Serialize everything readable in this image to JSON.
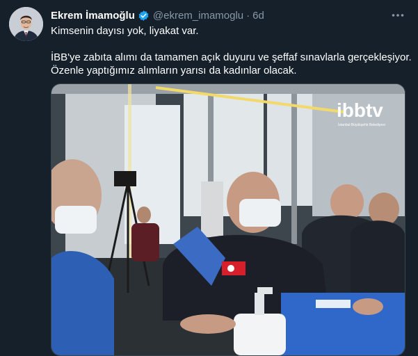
{
  "tweet": {
    "author_name": "Ekrem İmamoğlu",
    "handle": "@ekrem_imamoglu",
    "separator": "·",
    "time": "6d",
    "lines": [
      "Kimsenin dayısı yok, liyakat var.",
      "İBB'ye zabıta alımı da tamamen açık duyuru ve şeffaf sınavlarla gerçekleşiyor.",
      "Özenle yaptığımız alımların yarısı da kadınlar olacak."
    ]
  },
  "media": {
    "logo_text": "ibbtv",
    "logo_subtitle": "İstanbul Büyükşehir Belediyesi"
  },
  "icons": {
    "verified": "verified-badge-icon",
    "more": "more-dots-icon"
  },
  "colors": {
    "background": "#15202b",
    "secondary_text": "#8899a6",
    "verified": "#1da1f2"
  }
}
